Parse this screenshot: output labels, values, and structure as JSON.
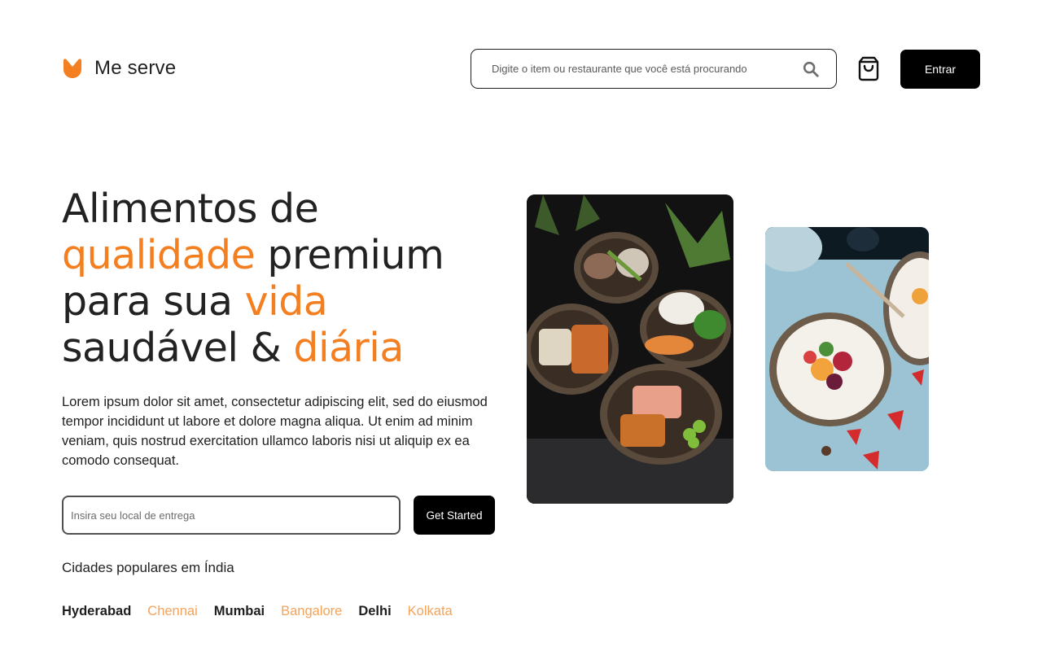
{
  "brand": {
    "name": "Me serve",
    "accent_color": "#f47f20",
    "logo_icon": "orange-v-logo-icon"
  },
  "header": {
    "search_placeholder": "Digite o item ou restaurante que você está procurando",
    "search_icon": "search-icon",
    "cart_icon": "shopping-bag-icon",
    "login_label": "Entrar"
  },
  "hero": {
    "headline": {
      "part1": "Alimentos de",
      "part2_accent": "qualidade",
      "part3": " premium",
      "part4": "para sua ",
      "part5_accent": "vida",
      "part6": "saudável & ",
      "part7_accent": "diária"
    },
    "lead": "Lorem ipsum dolor sit amet, consectetur adipiscing elit, sed do eiusmod tempor incididunt ut labore et dolore magna aliqua. Ut enim ad minim veniam, quis nostrud exercitation ullamco laboris nisi ut aliquip ex ea comodo consequat.",
    "delivery_placeholder": "Insira seu local de entrega",
    "cta_label": "Get Started",
    "cities_title": "Cidades populares em Índia",
    "cities": [
      {
        "name": "Hyderabad",
        "highlight": false
      },
      {
        "name": "Chennai",
        "highlight": true
      },
      {
        "name": "Mumbai",
        "highlight": false
      },
      {
        "name": "Bangalore",
        "highlight": true
      },
      {
        "name": "Delhi",
        "highlight": false
      },
      {
        "name": "Kolkata",
        "highlight": true
      }
    ]
  }
}
